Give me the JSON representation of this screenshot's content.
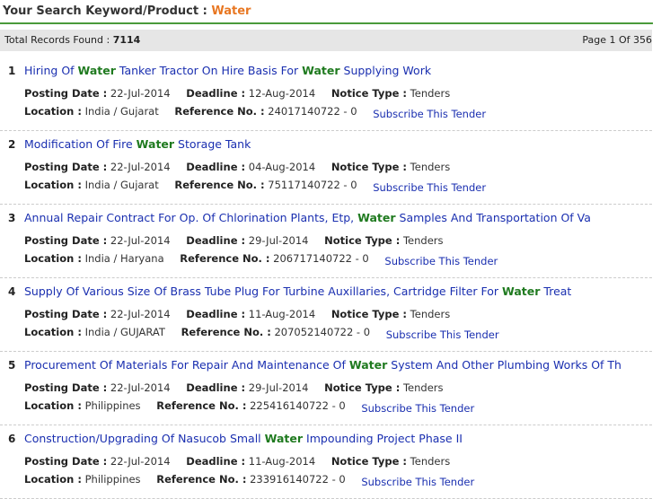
{
  "header": {
    "label": "Your Search Keyword/Product :",
    "keyword": "Water"
  },
  "summary": {
    "records_label": "Total Records Found :",
    "records_count": "7114",
    "page_text": "Page 1 Of 356"
  },
  "labels": {
    "posting_date": "Posting Date :",
    "deadline": "Deadline :",
    "notice_type": "Notice Type :",
    "location": "Location :",
    "reference": "Reference No. :",
    "subscribe": "Subscribe This Tender"
  },
  "tenders": [
    {
      "num": "1",
      "title_parts": [
        "Hiring Of ",
        "Water",
        " Tanker Tractor On Hire Basis For ",
        "Water",
        " Supplying Work"
      ],
      "posting_date": "22-Jul-2014",
      "deadline": "12-Aug-2014",
      "notice_type": "Tenders",
      "location": "India / Gujarat",
      "reference": "24017140722 - 0"
    },
    {
      "num": "2",
      "title_parts": [
        "Modification Of Fire ",
        "Water",
        " Storage Tank"
      ],
      "posting_date": "22-Jul-2014",
      "deadline": "04-Aug-2014",
      "notice_type": "Tenders",
      "location": "India / Gujarat",
      "reference": "75117140722 - 0"
    },
    {
      "num": "3",
      "title_parts": [
        "Annual Repair Contract For Op. Of Chlorination Plants, Etp, ",
        "Water",
        " Samples And Transportation Of Va"
      ],
      "posting_date": "22-Jul-2014",
      "deadline": "29-Jul-2014",
      "notice_type": "Tenders",
      "location": "India / Haryana",
      "reference": "206717140722 - 0"
    },
    {
      "num": "4",
      "title_parts": [
        "Supply Of Various Size Of Brass Tube Plug For Turbine Auxillaries, Cartridge Filter For ",
        "Water",
        " Treat"
      ],
      "posting_date": "22-Jul-2014",
      "deadline": "11-Aug-2014",
      "notice_type": "Tenders",
      "location": "India / GUJARAT",
      "reference": "207052140722 - 0"
    },
    {
      "num": "5",
      "title_parts": [
        "Procurement Of Materials For Repair And Maintenance Of ",
        "Water",
        " System And Other Plumbing Works Of Th"
      ],
      "posting_date": "22-Jul-2014",
      "deadline": "29-Jul-2014",
      "notice_type": "Tenders",
      "location": "Philippines",
      "reference": "225416140722 - 0"
    },
    {
      "num": "6",
      "title_parts": [
        "Construction/Upgrading Of Nasucob Small ",
        "Water",
        " Impounding Project Phase II"
      ],
      "posting_date": "22-Jul-2014",
      "deadline": "11-Aug-2014",
      "notice_type": "Tenders",
      "location": "Philippines",
      "reference": "233916140722 - 0"
    }
  ]
}
